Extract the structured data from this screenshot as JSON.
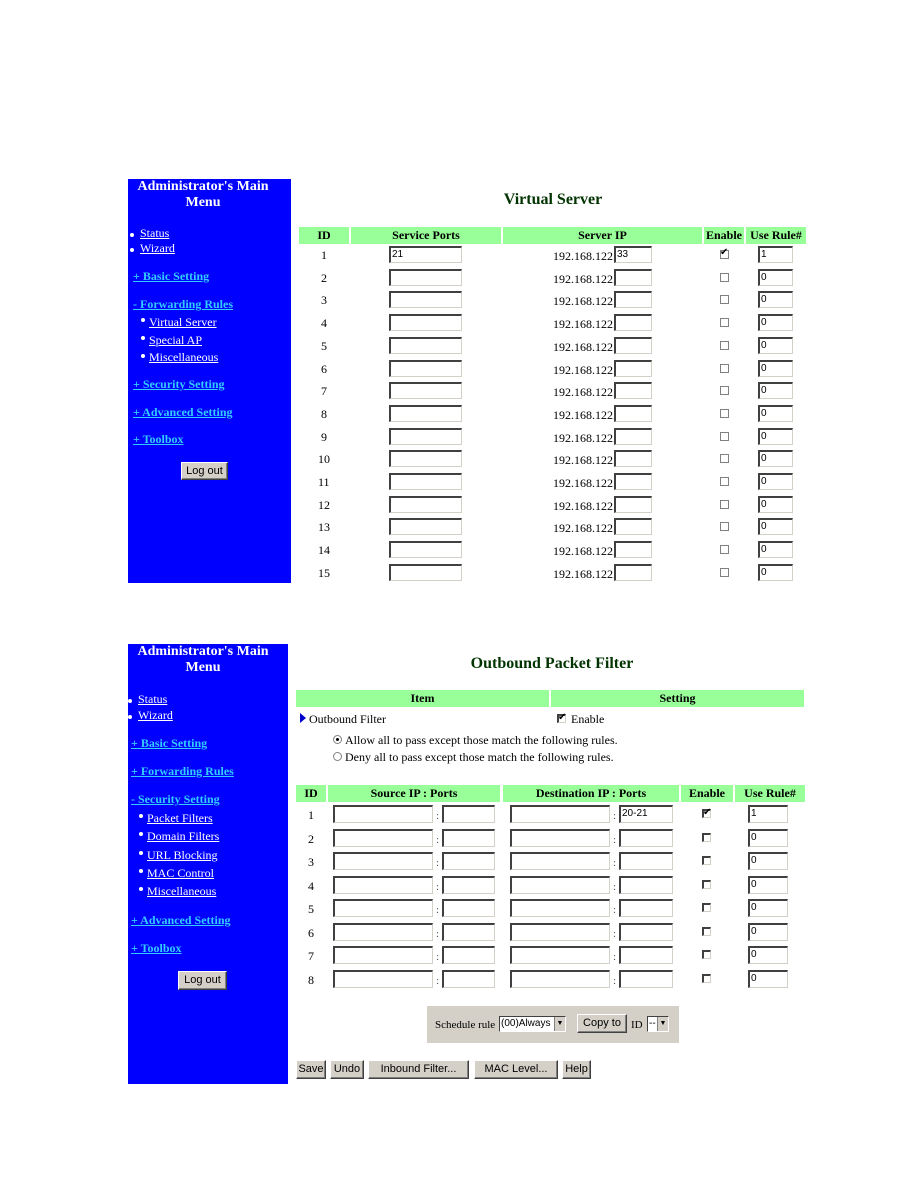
{
  "colors": {
    "sidebar_bg": "#0000ff",
    "header_bg": "#99ff99",
    "title_color": "#003300",
    "section_link": "#33ccff"
  },
  "panel1": {
    "menu_title_line1": "Administrator's Main",
    "menu_title_line2": "Menu",
    "menu": {
      "status": "Status",
      "wizard": "Wizard",
      "basic_setting": "+ Basic Setting",
      "forwarding_rules": "- Forwarding Rules",
      "sub_items": [
        "Virtual Server",
        "Special AP",
        "Miscellaneous"
      ],
      "security_setting": "+ Security Setting",
      "advanced_setting": "+ Advanced Setting",
      "toolbox": "+ Toolbox",
      "logout": "Log out"
    },
    "page_title": "Virtual Server",
    "headers": {
      "id": "ID",
      "service_ports": "Service Ports",
      "server_ip": "Server IP",
      "enable": "Enable",
      "use_rule": "Use Rule#"
    },
    "ip_prefix": "192.168.122.",
    "rows": [
      {
        "id": "1",
        "service_ports": "21",
        "ip_suffix": "33",
        "enabled": true,
        "use_rule": "1"
      },
      {
        "id": "2",
        "service_ports": "",
        "ip_suffix": "",
        "enabled": false,
        "use_rule": "0"
      },
      {
        "id": "3",
        "service_ports": "",
        "ip_suffix": "",
        "enabled": false,
        "use_rule": "0"
      },
      {
        "id": "4",
        "service_ports": "",
        "ip_suffix": "",
        "enabled": false,
        "use_rule": "0"
      },
      {
        "id": "5",
        "service_ports": "",
        "ip_suffix": "",
        "enabled": false,
        "use_rule": "0"
      },
      {
        "id": "6",
        "service_ports": "",
        "ip_suffix": "",
        "enabled": false,
        "use_rule": "0"
      },
      {
        "id": "7",
        "service_ports": "",
        "ip_suffix": "",
        "enabled": false,
        "use_rule": "0"
      },
      {
        "id": "8",
        "service_ports": "",
        "ip_suffix": "",
        "enabled": false,
        "use_rule": "0"
      },
      {
        "id": "9",
        "service_ports": "",
        "ip_suffix": "",
        "enabled": false,
        "use_rule": "0"
      },
      {
        "id": "10",
        "service_ports": "",
        "ip_suffix": "",
        "enabled": false,
        "use_rule": "0"
      },
      {
        "id": "11",
        "service_ports": "",
        "ip_suffix": "",
        "enabled": false,
        "use_rule": "0"
      },
      {
        "id": "12",
        "service_ports": "",
        "ip_suffix": "",
        "enabled": false,
        "use_rule": "0"
      },
      {
        "id": "13",
        "service_ports": "",
        "ip_suffix": "",
        "enabled": false,
        "use_rule": "0"
      },
      {
        "id": "14",
        "service_ports": "",
        "ip_suffix": "",
        "enabled": false,
        "use_rule": "0"
      },
      {
        "id": "15",
        "service_ports": "",
        "ip_suffix": "",
        "enabled": false,
        "use_rule": "0"
      }
    ]
  },
  "panel2": {
    "menu_title_line1": "Administrator's Main",
    "menu_title_line2": "Menu",
    "menu": {
      "status": "Status",
      "wizard": "Wizard",
      "basic_setting": "+ Basic Setting",
      "forwarding_rules": "+ Forwarding Rules",
      "security_setting": "- Security Setting",
      "sub_items": [
        "Packet Filters",
        "Domain Filters",
        "URL Blocking",
        "MAC Control",
        "Miscellaneous"
      ],
      "advanced_setting": "+ Advanced Setting",
      "toolbox": "+ Toolbox",
      "logout": "Log out"
    },
    "page_title": "Outbound Packet Filter",
    "top_headers": {
      "item": "Item",
      "setting": "Setting"
    },
    "outbound_filter_label": "Outbound Filter",
    "enable_label": "Enable",
    "outbound_filter_enabled": true,
    "policy_options": [
      {
        "label": "Allow all to pass except those match the following rules.",
        "selected": true
      },
      {
        "label": "Deny all to pass except those match the following rules.",
        "selected": false
      }
    ],
    "headers": {
      "id": "ID",
      "source": "Source IP : Ports",
      "destination": "Destination IP : Ports",
      "enable": "Enable",
      "use_rule": "Use Rule#"
    },
    "rows": [
      {
        "id": "1",
        "src_ip": "",
        "src_ports": "",
        "dst_ip": "",
        "dst_ports": "20-21",
        "enabled": true,
        "use_rule": "1"
      },
      {
        "id": "2",
        "src_ip": "",
        "src_ports": "",
        "dst_ip": "",
        "dst_ports": "",
        "enabled": false,
        "use_rule": "0"
      },
      {
        "id": "3",
        "src_ip": "",
        "src_ports": "",
        "dst_ip": "",
        "dst_ports": "",
        "enabled": false,
        "use_rule": "0"
      },
      {
        "id": "4",
        "src_ip": "",
        "src_ports": "",
        "dst_ip": "",
        "dst_ports": "",
        "enabled": false,
        "use_rule": "0"
      },
      {
        "id": "5",
        "src_ip": "",
        "src_ports": "",
        "dst_ip": "",
        "dst_ports": "",
        "enabled": false,
        "use_rule": "0"
      },
      {
        "id": "6",
        "src_ip": "",
        "src_ports": "",
        "dst_ip": "",
        "dst_ports": "",
        "enabled": false,
        "use_rule": "0"
      },
      {
        "id": "7",
        "src_ip": "",
        "src_ports": "",
        "dst_ip": "",
        "dst_ports": "",
        "enabled": false,
        "use_rule": "0"
      },
      {
        "id": "8",
        "src_ip": "",
        "src_ports": "",
        "dst_ip": "",
        "dst_ports": "",
        "enabled": false,
        "use_rule": "0"
      }
    ],
    "schedule": {
      "label": "Schedule rule",
      "selected": "(00)Always",
      "copy_to": "Copy to",
      "id_label": "ID",
      "id_selected": "--"
    },
    "buttons": {
      "save": "Save",
      "undo": "Undo",
      "inbound_filter": "Inbound Filter...",
      "mac_level": "MAC Level...",
      "help": "Help"
    }
  }
}
